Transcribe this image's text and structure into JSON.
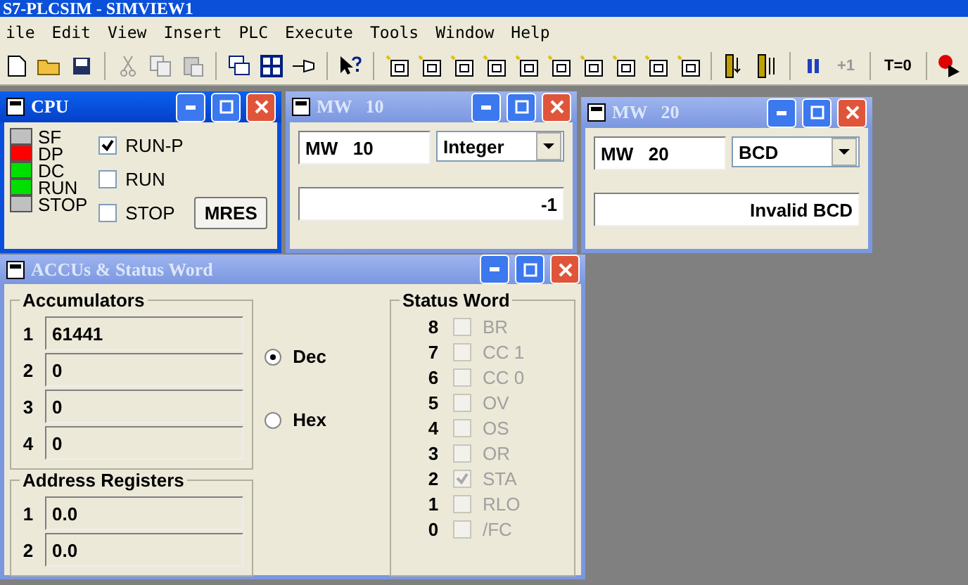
{
  "app_title": "S7-PLCSIM - SIMVIEW1",
  "menu": [
    "ile",
    "Edit",
    "View",
    "Insert",
    "PLC",
    "Execute",
    "Tools",
    "Window",
    "Help"
  ],
  "toolbar": {
    "step_label": "+1",
    "timer_label": "T=0"
  },
  "cpu": {
    "title": "CPU",
    "active": true,
    "leds": [
      {
        "label": "SF",
        "color": "#c0c0c0"
      },
      {
        "label": "DP",
        "color": "#ff0000"
      },
      {
        "label": "DC",
        "color": "#00e000"
      },
      {
        "label": "RUN",
        "color": "#00e000"
      },
      {
        "label": "STOP",
        "color": "#c0c0c0"
      }
    ],
    "modes": [
      {
        "label": "RUN-P",
        "checked": true
      },
      {
        "label": "RUN",
        "checked": false
      },
      {
        "label": "STOP",
        "checked": false
      }
    ],
    "button": "MRES"
  },
  "monitors": [
    {
      "title": "MW   10",
      "active": false,
      "address": "MW   10",
      "format": "Integer",
      "value": "-1"
    },
    {
      "title": "MW   20",
      "active": false,
      "address": "MW   20",
      "format": "BCD",
      "value": "Invalid BCD"
    }
  ],
  "accus": {
    "title": "ACCUs & Status Word",
    "active": false,
    "accumulators_label": "Accumulators",
    "accumulators": [
      {
        "index": "1",
        "value": "61441"
      },
      {
        "index": "2",
        "value": "0"
      },
      {
        "index": "3",
        "value": "0"
      },
      {
        "index": "4",
        "value": "0"
      }
    ],
    "address_label": "Address Registers",
    "address_registers": [
      {
        "index": "1",
        "value": "0.0"
      },
      {
        "index": "2",
        "value": "0.0"
      }
    ],
    "radix": [
      {
        "label": "Dec",
        "selected": true
      },
      {
        "label": "Hex",
        "selected": false
      }
    ],
    "status_label": "Status Word",
    "status_bits": [
      {
        "bit": "8",
        "label": "BR",
        "checked": false,
        "disabled": true
      },
      {
        "bit": "7",
        "label": "CC 1",
        "checked": false,
        "disabled": true
      },
      {
        "bit": "6",
        "label": "CC 0",
        "checked": false,
        "disabled": true
      },
      {
        "bit": "5",
        "label": "OV",
        "checked": false,
        "disabled": true
      },
      {
        "bit": "4",
        "label": "OS",
        "checked": false,
        "disabled": true
      },
      {
        "bit": "3",
        "label": "OR",
        "checked": false,
        "disabled": true
      },
      {
        "bit": "2",
        "label": "STA",
        "checked": true,
        "disabled": true
      },
      {
        "bit": "1",
        "label": "RLO",
        "checked": false,
        "disabled": true
      },
      {
        "bit": "0",
        "label": "/FC",
        "checked": false,
        "disabled": true
      }
    ]
  }
}
